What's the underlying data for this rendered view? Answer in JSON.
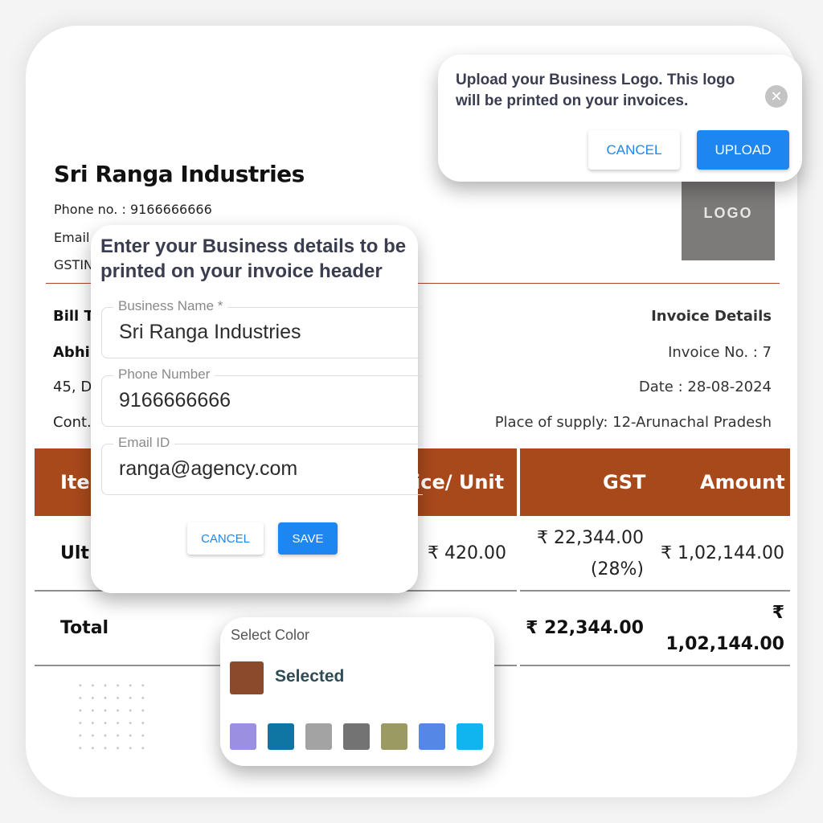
{
  "invoice": {
    "business_name": "Sri Ranga Industries",
    "phone_line": "Phone no. : 9166666666",
    "email_line_visible": "Email",
    "gstin_line_visible": "GSTIN",
    "logo_placeholder": "LOGO",
    "bill_to": {
      "heading_visible": "Bill T",
      "name_visible": "Abhi",
      "address_visible": "45, D",
      "contact_visible": "Cont."
    },
    "details": {
      "heading": "Invoice Details",
      "invoice_no": "Invoice No. : 7",
      "date": "Date : 28-08-2024",
      "place_of_supply": "Place of supply: 12-Arunachal Pradesh"
    },
    "table": {
      "headers": {
        "item_visible": "Ite",
        "price_per_unit_visible": "ice/ Unit",
        "gst": "GST",
        "amount": "Amount"
      },
      "rows": [
        {
          "item_visible": "Ult",
          "price_per_unit": "₹ 420.00",
          "gst_amount": "₹ 22,344.00",
          "gst_rate": "(28%)",
          "amount": "₹ 1,02,144.00"
        }
      ],
      "total": {
        "label": "Total",
        "gst": "₹ 22,344.00",
        "amount_symbol": "₹",
        "amount_value": "1,02,144.00"
      }
    },
    "theme_color": "#a8491c"
  },
  "upload_popup": {
    "message": "Upload your Business Logo. This logo will be printed on your invoices.",
    "close_icon": "close-icon",
    "cancel_label": "CANCEL",
    "upload_label": "UPLOAD"
  },
  "details_popup": {
    "title": "Enter your Business details to be printed on your invoice header",
    "fields": [
      {
        "label": "Business Name *",
        "value": "Sri Ranga Industries"
      },
      {
        "label": "Phone Number",
        "value": "9166666666"
      },
      {
        "label": "Email ID",
        "value": "ranga@agency.com"
      }
    ],
    "cancel_label": "CANCEL",
    "save_label": "SAVE"
  },
  "color_popup": {
    "title": "Select Color",
    "selected_label": "Selected",
    "selected_color": "#8b4a2b",
    "options": [
      "#9a8fe0",
      "#0f76a3",
      "#a3a3a3",
      "#737373",
      "#9a9a62",
      "#5588e6",
      "#10b4ef"
    ]
  },
  "colors": {
    "primary_button": "#1e86f0",
    "header_rule": "#a9492a"
  }
}
